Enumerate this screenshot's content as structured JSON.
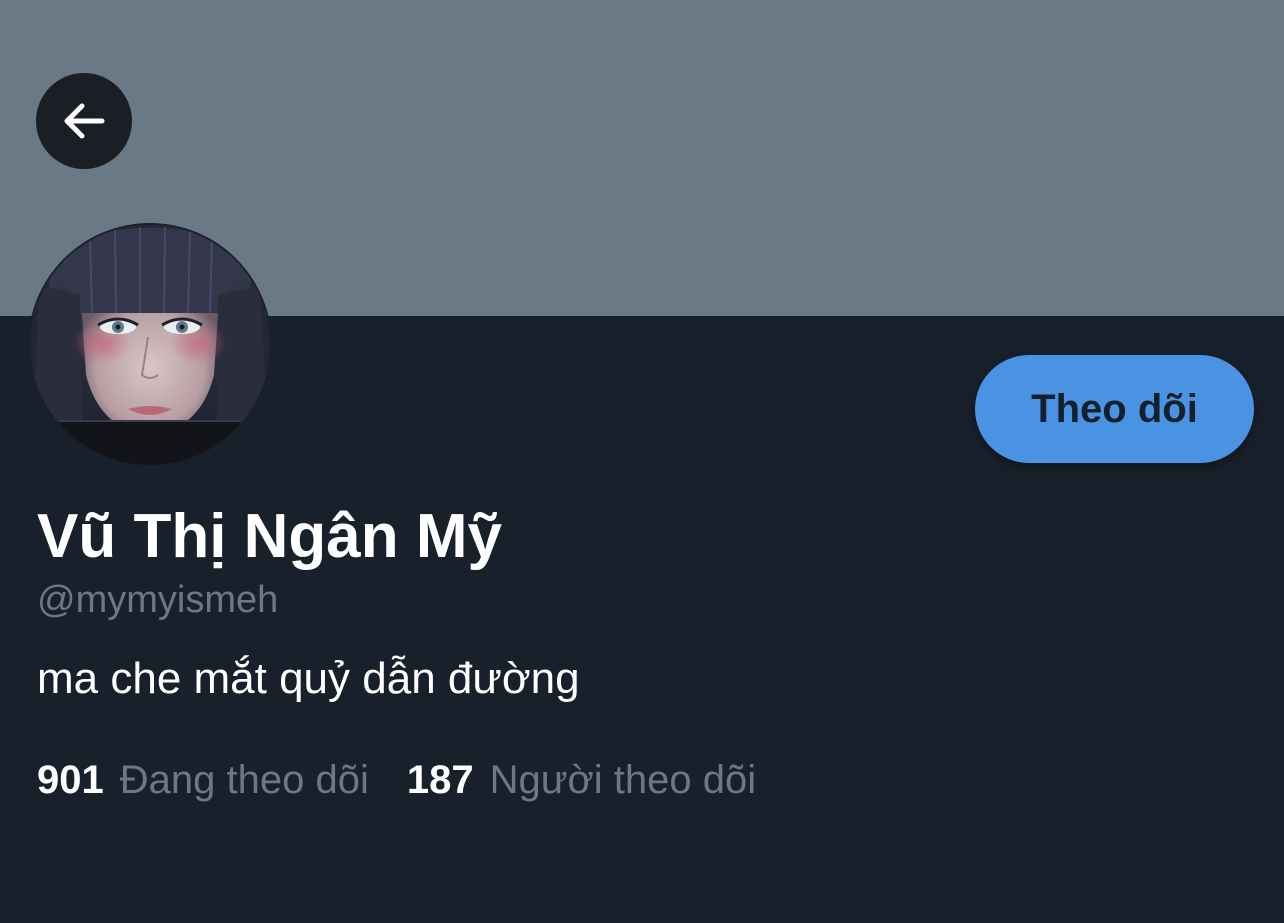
{
  "profile": {
    "display_name": "Vũ Thị Ngân Mỹ",
    "handle": "@mymyismeh",
    "bio": "ma che mắt quỷ dẫn đường"
  },
  "actions": {
    "follow_label": "Theo dõi"
  },
  "stats": {
    "following": {
      "count": "901",
      "label": "Đang theo dõi"
    },
    "followers": {
      "count": "187",
      "label": "Người theo dõi"
    }
  },
  "icons": {
    "back": "arrow-left-icon"
  },
  "colors": {
    "banner": "#6b7986",
    "background": "#18202b",
    "accent": "#4a93e3",
    "muted_text": "#6d7882"
  }
}
